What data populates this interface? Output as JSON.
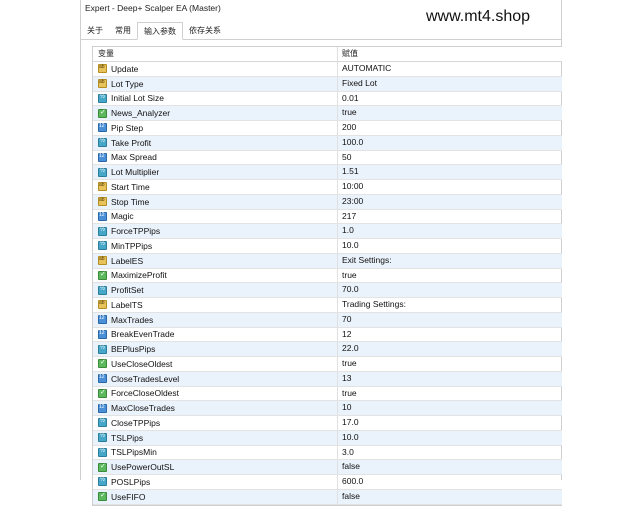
{
  "window": {
    "title": "Expert - Deep+ Scalper EA (Master)"
  },
  "watermark": "www.mt4.shop",
  "tabs": [
    {
      "label": "关于",
      "active": false
    },
    {
      "label": "常用",
      "active": false
    },
    {
      "label": "输入参数",
      "active": true
    },
    {
      "label": "依存关系",
      "active": false
    }
  ],
  "table": {
    "headers": {
      "variable": "变量",
      "value": "赋值"
    },
    "rows": [
      {
        "name": "Update",
        "value": "AUTOMATIC",
        "icon": "ab"
      },
      {
        "name": "Lot Type",
        "value": "Fixed Lot",
        "icon": "ab"
      },
      {
        "name": "Initial Lot Size",
        "value": "0.01",
        "icon": "dbl"
      },
      {
        "name": "News_Analyzer",
        "value": "true",
        "icon": "bool"
      },
      {
        "name": "Pip Step",
        "value": "200",
        "icon": "num"
      },
      {
        "name": "Take Profit",
        "value": "100.0",
        "icon": "dbl"
      },
      {
        "name": "Max Spread",
        "value": "50",
        "icon": "num"
      },
      {
        "name": "Lot Multiplier",
        "value": "1.51",
        "icon": "dbl"
      },
      {
        "name": "Start Time",
        "value": "10:00",
        "icon": "ab"
      },
      {
        "name": "Stop Time",
        "value": "23:00",
        "icon": "ab"
      },
      {
        "name": "Magic",
        "value": "217",
        "icon": "num"
      },
      {
        "name": "ForceTPPips",
        "value": "1.0",
        "icon": "dbl"
      },
      {
        "name": "MinTPPips",
        "value": "10.0",
        "icon": "dbl"
      },
      {
        "name": "LabelES",
        "value": "Exit Settings:",
        "icon": "ab"
      },
      {
        "name": "MaximizeProfit",
        "value": "true",
        "icon": "bool"
      },
      {
        "name": "ProfitSet",
        "value": "70.0",
        "icon": "dbl"
      },
      {
        "name": "LabelTS",
        "value": "Trading Settings:",
        "icon": "ab"
      },
      {
        "name": "MaxTrades",
        "value": "70",
        "icon": "num"
      },
      {
        "name": "BreakEvenTrade",
        "value": "12",
        "icon": "num"
      },
      {
        "name": "BEPlusPips",
        "value": "22.0",
        "icon": "dbl"
      },
      {
        "name": "UseCloseOldest",
        "value": "true",
        "icon": "bool"
      },
      {
        "name": "CloseTradesLevel",
        "value": "13",
        "icon": "num"
      },
      {
        "name": "ForceCloseOldest",
        "value": "true",
        "icon": "bool"
      },
      {
        "name": "MaxCloseTrades",
        "value": "10",
        "icon": "num"
      },
      {
        "name": "CloseTPPips",
        "value": "17.0",
        "icon": "dbl"
      },
      {
        "name": "TSLPips",
        "value": "10.0",
        "icon": "dbl"
      },
      {
        "name": "TSLPipsMin",
        "value": "3.0",
        "icon": "dbl"
      },
      {
        "name": "UsePowerOutSL",
        "value": "false",
        "icon": "bool"
      },
      {
        "name": "POSLPips",
        "value": "600.0",
        "icon": "dbl"
      },
      {
        "name": "UseFIFO",
        "value": "false",
        "icon": "bool"
      }
    ]
  }
}
